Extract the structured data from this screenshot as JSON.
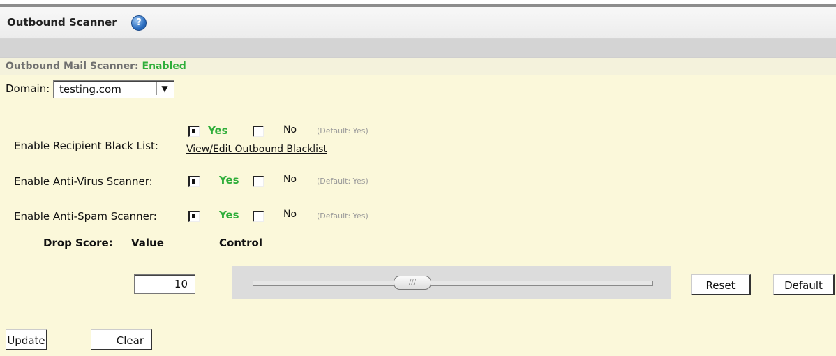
{
  "header": {
    "title": "Outbound Scanner",
    "help_icon": "?"
  },
  "status": {
    "label": "Outbound Mail Scanner:",
    "value": "Enabled"
  },
  "domain": {
    "label": "Domain:",
    "selected": "testing.com",
    "arrow": "▼"
  },
  "settings": [
    {
      "label": "Enable Recipient Black List:",
      "selected": "Yes",
      "yes_label": "Yes",
      "no_label": "No",
      "default_text": "(Default: Yes)",
      "link": "View/Edit Outbound Blacklist"
    },
    {
      "label": "Enable Anti-Virus Scanner:",
      "selected": "Yes",
      "yes_label": "Yes",
      "no_label": "No",
      "default_text": "(Default: Yes)"
    },
    {
      "label": "Enable Anti-Spam Scanner:",
      "selected": "Yes",
      "yes_label": "Yes",
      "no_label": "No",
      "default_text": "(Default: Yes)"
    }
  ],
  "drop_score": {
    "label": "Drop Score:",
    "value_header": "Value",
    "control_header": "Control",
    "value": "10",
    "thumb_glyph": "///",
    "reset_label": "Reset",
    "default_label": "Default"
  },
  "actions": {
    "update_label": "Update",
    "clear_label": "Clear"
  },
  "colors": {
    "accent_green": "#2fae3a",
    "content_bg": "#fbf8da"
  }
}
